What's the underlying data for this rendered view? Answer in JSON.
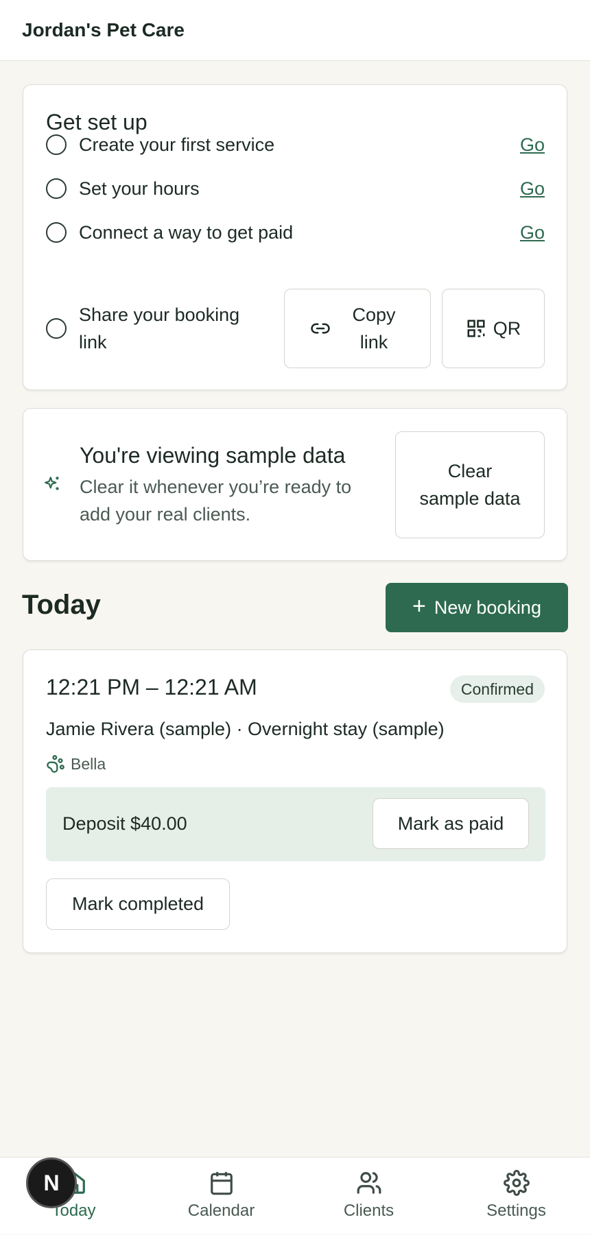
{
  "app": {
    "title": "Jordan's Pet Care"
  },
  "setup": {
    "title": "Get set up",
    "steps": [
      {
        "label": "Create your first service",
        "action": "Go",
        "done": false
      },
      {
        "label": "Set your hours",
        "action": "Go",
        "done": false
      },
      {
        "label": "Connect a way to get paid",
        "action": "Go",
        "done": false
      }
    ],
    "share": {
      "label": "Share your booking link",
      "copy_label": "Copy link",
      "qr_label": "QR",
      "done": false
    }
  },
  "sample_notice": {
    "icon": "sparkle-icon",
    "title": "You're viewing sample data",
    "description": "Clear it whenever you’re ready to add your real clients.",
    "clear_label": "Clear sample data"
  },
  "today": {
    "heading": "Today",
    "new_booking_label": "New booking"
  },
  "booking": {
    "time": "12:21 PM – 12:21 AM",
    "status": "Confirmed",
    "summary": "Jamie Rivera (sample) · Overnight stay (sample)",
    "pet": "Bella",
    "deposit_text": "Deposit $40.00",
    "mark_paid_label": "Mark as paid",
    "mark_completed_label": "Mark completed"
  },
  "nav": {
    "items": [
      {
        "label": "Today",
        "icon": "home-icon",
        "active": true
      },
      {
        "label": "Calendar",
        "icon": "calendar-icon",
        "active": false
      },
      {
        "label": "Clients",
        "icon": "clients-icon",
        "active": false
      },
      {
        "label": "Settings",
        "icon": "gear-icon",
        "active": false
      }
    ]
  },
  "dev_badge": {
    "letter": "N"
  },
  "colors": {
    "accent": "#2d6a4f",
    "background": "#f8f6f0",
    "deposit_bg": "#e5efe8"
  }
}
